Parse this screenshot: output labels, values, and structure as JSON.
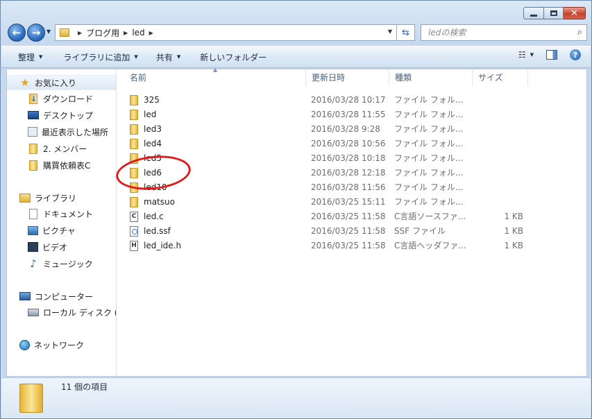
{
  "window": {
    "caption_buttons": {
      "minimize": "",
      "maximize": "",
      "close": "✕"
    }
  },
  "address_bar": {
    "crumbs": [
      "ブログ用",
      "led"
    ],
    "search_placeholder": "ledの検索"
  },
  "toolbar": {
    "organize": "整理",
    "add_to_library": "ライブラリに追加",
    "share": "共有",
    "new_folder": "新しいフォルダー"
  },
  "nav_pane": {
    "favorites": {
      "label": "お気に入り",
      "items": [
        "ダウンロード",
        "デスクトップ",
        "最近表示した場所",
        "2. メンバー",
        "購買依頼表C"
      ]
    },
    "libraries": {
      "label": "ライブラリ",
      "items": [
        "ドキュメント",
        "ピクチャ",
        "ビデオ",
        "ミュージック"
      ]
    },
    "computer": {
      "label": "コンピューター",
      "items": [
        "ローカル ディスク ("
      ]
    },
    "network": {
      "label": "ネットワーク"
    }
  },
  "file_list": {
    "columns": [
      "名前",
      "更新日時",
      "種類",
      "サイズ"
    ],
    "rows": [
      {
        "name": "325",
        "date": "2016/03/28 10:17",
        "type": "ファイル フォル...",
        "size": "",
        "icon": "folder-icon"
      },
      {
        "name": "led",
        "date": "2016/03/28 11:55",
        "type": "ファイル フォル...",
        "size": "",
        "icon": "folder-icon"
      },
      {
        "name": "led3",
        "date": "2016/03/28 9:28",
        "type": "ファイル フォル...",
        "size": "",
        "icon": "folder-icon"
      },
      {
        "name": "led4",
        "date": "2016/03/28 10:56",
        "type": "ファイル フォル...",
        "size": "",
        "icon": "folder-icon"
      },
      {
        "name": "led5",
        "date": "2016/03/28 10:18",
        "type": "ファイル フォル...",
        "size": "",
        "icon": "folder-icon"
      },
      {
        "name": "led6",
        "date": "2016/03/28 12:18",
        "type": "ファイル フォル...",
        "size": "",
        "icon": "folder-icon"
      },
      {
        "name": "led10",
        "date": "2016/03/28 11:56",
        "type": "ファイル フォル...",
        "size": "",
        "icon": "folder-icon"
      },
      {
        "name": "matsuo",
        "date": "2016/03/25 15:11",
        "type": "ファイル フォル...",
        "size": "",
        "icon": "folder-icon"
      },
      {
        "name": "led.c",
        "date": "2016/03/25 11:58",
        "type": "C言語ソースファ...",
        "size": "1 KB",
        "icon": "c-file-icon"
      },
      {
        "name": "led.ssf",
        "date": "2016/03/25 11:58",
        "type": "SSF ファイル",
        "size": "1 KB",
        "icon": "ssf-file-icon"
      },
      {
        "name": "led_ide.h",
        "date": "2016/03/25 11:58",
        "type": "C言語ヘッダファ...",
        "size": "1 KB",
        "icon": "h-file-icon"
      }
    ]
  },
  "details_pane": {
    "item_count": "11 個の項目"
  },
  "colors": {
    "annotation": "#e41919",
    "accent": "#2f6fbf"
  }
}
